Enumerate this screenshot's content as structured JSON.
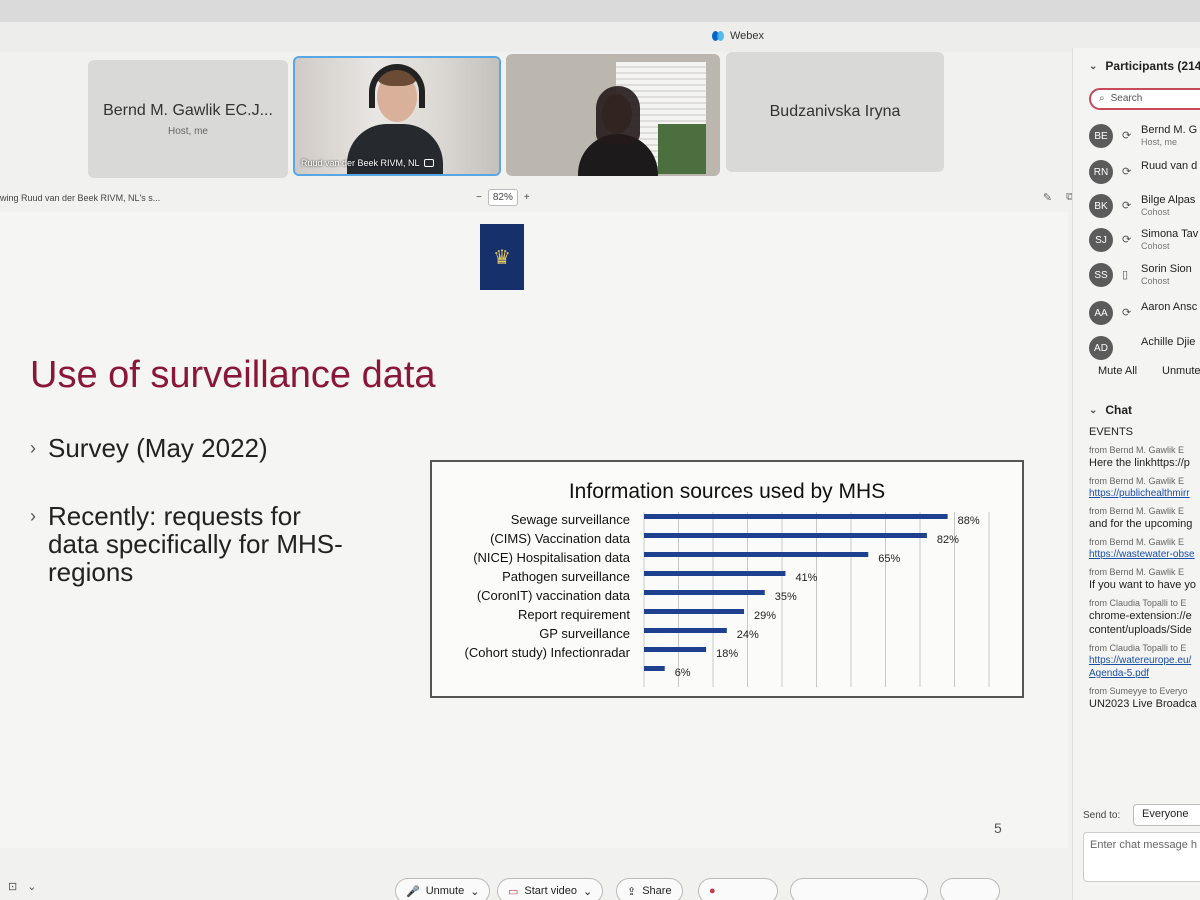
{
  "window": {
    "title": "Webex"
  },
  "tiles": {
    "host_name": "Bernd M. Gawlik EC.J...",
    "host_sub": "Host, me",
    "video1_label": "Ruud van der Beek RIVM, NL",
    "right_name": "Budzanivska Iryna"
  },
  "share_bar": {
    "viewing_text": "wing Ruud van der Beek RIVM, NL's s...",
    "zoom_minus": "−",
    "zoom_value": "82%",
    "zoom_plus": "+"
  },
  "slide": {
    "title": "Use of surveillance data",
    "bullet1": "Survey (May 2022)",
    "bullet2_line1": "Recently: requests for",
    "bullet2_line2": "data specifically for MHS-",
    "bullet2_line3": "regions",
    "slide_number": "5"
  },
  "chart_data": {
    "type": "bar",
    "orientation": "horizontal",
    "title": "Information sources used by MHS",
    "categories": [
      "Sewage surveillance",
      "(CIMS) Vaccination data",
      "(NICE) Hospitalisation data",
      "Pathogen surveillance",
      "(CoronIT) vaccination data",
      "Report requirement",
      "GP surveillance",
      "(Cohort study) Infectionradar"
    ],
    "values": [
      88,
      82,
      65,
      41,
      35,
      29,
      24,
      18,
      6
    ],
    "value_labels": [
      "88%",
      "82%",
      "65%",
      "41%",
      "35%",
      "29%",
      "24%",
      "18%",
      "6%"
    ],
    "xticks": [
      "0%",
      "10%",
      "20%",
      "30%",
      "40%",
      "50%",
      "60%",
      "70%",
      "80%",
      "90%",
      "100%"
    ],
    "xlim": [
      0,
      100
    ],
    "grid": true,
    "bar_color": "#1f3f8f"
  },
  "participants": {
    "header": "Participants (214",
    "search_placeholder": "Search",
    "list": [
      {
        "initials": "BE",
        "name": "Bernd M. G",
        "role": "Host, me"
      },
      {
        "initials": "RN",
        "name": "Ruud van d",
        "role": ""
      },
      {
        "initials": "BK",
        "name": "Bilge Alpas",
        "role": "Cohost"
      },
      {
        "initials": "SJ",
        "name": "Simona Tav",
        "role": "Cohost"
      },
      {
        "initials": "SS",
        "name": "Sorin Sion",
        "role": "Cohost"
      },
      {
        "initials": "AA",
        "name": "Aaron Ansc",
        "role": ""
      },
      {
        "initials": "AD",
        "name": "Achille Djie",
        "role": ""
      }
    ],
    "mute_all": "Mute All",
    "unmute_all": "Unmute"
  },
  "chat": {
    "header": "Chat",
    "messages": [
      {
        "kind": "text",
        "text": "EVENTS"
      },
      {
        "kind": "from",
        "text": "from Bernd M. Gawlik E"
      },
      {
        "kind": "text",
        "text": "Here the linkhttps://p"
      },
      {
        "kind": "from",
        "text": "from Bernd M. Gawlik E"
      },
      {
        "kind": "link",
        "text": "https://publichealthmirr"
      },
      {
        "kind": "from",
        "text": "from Bernd M. Gawlik E"
      },
      {
        "kind": "text",
        "text": "and for the upcoming"
      },
      {
        "kind": "from",
        "text": "from Bernd M. Gawlik E"
      },
      {
        "kind": "link",
        "text": "https://wastewater-obse"
      },
      {
        "kind": "from",
        "text": "from Bernd M. Gawlik E"
      },
      {
        "kind": "text",
        "text": "If you want to have yo"
      },
      {
        "kind": "from",
        "text": "from Claudia Topalli to E"
      },
      {
        "kind": "text",
        "text": "chrome-extension://e"
      },
      {
        "kind": "text",
        "text": "content/uploads/Side"
      },
      {
        "kind": "from",
        "text": "from Claudia Topalli to E"
      },
      {
        "kind": "link",
        "text": "https://watereurope.eu/"
      },
      {
        "kind": "link",
        "text": "Agenda-5.pdf"
      },
      {
        "kind": "from",
        "text": "from Sumeyye to Everyo"
      },
      {
        "kind": "text",
        "text": "UN2023 Live Broadca"
      }
    ],
    "send_to_label": "Send to:",
    "send_to_value": "Everyone",
    "input_placeholder": "Enter chat message h"
  },
  "controls": {
    "unmute": "Unmute",
    "start_video": "Start video",
    "share": "Share"
  },
  "colors": {
    "accent_title": "#8a1738",
    "selection_border": "#58a6e4",
    "search_border": "#c64a5a"
  }
}
